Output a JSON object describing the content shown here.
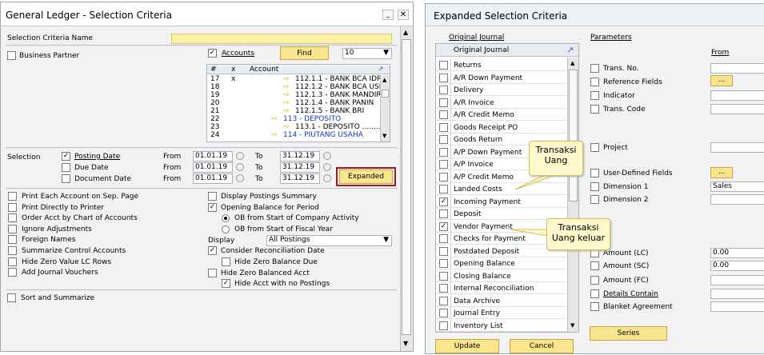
{
  "left": {
    "title": "General Ledger - Selection Criteria",
    "criteria_name_label": "Selection Criteria Name",
    "business_partner_label": "Business Partner",
    "accounts_label": "Accounts",
    "find_label": "Find",
    "count_value": "10",
    "grid_headers": [
      "#",
      "x",
      "Account"
    ],
    "grid_rows": [
      {
        "n": "17",
        "x": "x",
        "arrow": "⇨",
        "text": "112.1.1 - BANK BCA IDR",
        "blue": false,
        "indent": 1
      },
      {
        "n": "18",
        "x": "",
        "arrow": "⇨",
        "text": "112.1.2 - BANK BCA USD",
        "blue": false,
        "indent": 1
      },
      {
        "n": "19",
        "x": "",
        "arrow": "⇨",
        "text": "112.1.3 - BANK MANDIRI",
        "blue": false,
        "indent": 1
      },
      {
        "n": "20",
        "x": "",
        "arrow": "⇨",
        "text": "112.1.4 - BANK PANIN",
        "blue": false,
        "indent": 1
      },
      {
        "n": "21",
        "x": "",
        "arrow": "⇨",
        "text": "112.1.5 - BANK BRI",
        "blue": false,
        "indent": 1
      },
      {
        "n": "22",
        "x": "",
        "arrow": "⇨",
        "text": "113 - DEPOSITO",
        "blue": true,
        "indent": 0
      },
      {
        "n": "23",
        "x": "",
        "arrow": "⇨",
        "text": "113.1 - DEPOSITO ........",
        "blue": false,
        "indent": 1
      },
      {
        "n": "24",
        "x": "",
        "arrow": "⇨",
        "text": "114 - PIUTANG USAHA",
        "blue": true,
        "indent": 0
      }
    ],
    "selection_label": "Selection",
    "posting_date_label": "Posting Date",
    "due_date_label": "Due Date",
    "document_date_label": "Document Date",
    "from_label": "From",
    "to_label": "To",
    "dates": [
      {
        "from": "01.01.19",
        "to": "31.12.19"
      },
      {
        "from": "01.01.19",
        "to": "31.12.19"
      },
      {
        "from": "01.01.19",
        "to": "31.12.19"
      }
    ],
    "expanded_label": "Expanded",
    "opts_left": [
      "Print Each Account on Sep. Page",
      "Print Directly to Printer",
      "Order Acct by Chart of Accounts",
      "Ignore Adjustments",
      "Foreign Names",
      "Summarize Control Accounts",
      "Hide Zero Value LC Rows",
      "Add Journal Vouchers"
    ],
    "display_postings_summary": "Display Postings Summary",
    "opening_balance": "Opening Balance for Period",
    "ob_company": "OB from Start of Company Activity",
    "ob_fiscal": "OB from Start of Fiscal Year",
    "display_label": "Display",
    "display_value": "All Postings",
    "consider_recon": "Consider Reconciliation Date",
    "hide_zero_due": "Hide Zero Balance Due",
    "hide_zero_acct": "Hide Zero Balanced Acct",
    "hide_no_postings": "Hide Acct with no Postings",
    "sort_summarize": "Sort and Summarize"
  },
  "right": {
    "title": "Expanded Selection Criteria",
    "original_journal_tab": "Original Journal",
    "parameters_tab": "Parameters",
    "list_header": "Original Journal",
    "journal_items": [
      {
        "label": "Returns",
        "checked": false
      },
      {
        "label": "A/R Down Payment",
        "checked": false
      },
      {
        "label": "Delivery",
        "checked": false
      },
      {
        "label": "A/R Invoice",
        "checked": false
      },
      {
        "label": "A/R Credit Memo",
        "checked": false
      },
      {
        "label": "Goods Receipt PO",
        "checked": false
      },
      {
        "label": "Goods Return",
        "checked": false
      },
      {
        "label": "A/P Down Payment",
        "checked": false
      },
      {
        "label": "A/P Invoice",
        "checked": false
      },
      {
        "label": "A/P Credit Memo",
        "checked": false
      },
      {
        "label": "Landed Costs",
        "checked": false
      },
      {
        "label": "Incoming Payment",
        "checked": true
      },
      {
        "label": "Deposit",
        "checked": false
      },
      {
        "label": "Vendor Payment",
        "checked": true
      },
      {
        "label": "Checks for Payment",
        "checked": false
      },
      {
        "label": "Postdated Deposit",
        "checked": false
      },
      {
        "label": "Opening Balance",
        "checked": false
      },
      {
        "label": "Closing Balance",
        "checked": false
      },
      {
        "label": "Internal Reconciliation",
        "checked": false
      },
      {
        "label": "Data Archive",
        "checked": false
      },
      {
        "label": "Journal Entry",
        "checked": false
      },
      {
        "label": "Inventory List",
        "checked": false
      }
    ],
    "from_label": "From",
    "params": {
      "trans_no": "Trans. No.",
      "reference_fields": "Reference Fields",
      "indicator": "Indicator",
      "trans_code": "Trans. Code",
      "project": "Project",
      "udf": "User-Defined Fields",
      "dimension1": "Dimension 1",
      "dimension1_value": "Sales",
      "dimension2": "Dimension 2",
      "amount_lc": "Amount (LC)",
      "amount_lc_value": "0.00",
      "amount_sc": "Amount (SC)",
      "amount_sc_value": "0.00",
      "amount_fc": "Amount (FC)",
      "details_contain": "Details Contain",
      "blanket_agreement": "Blanket Agreement",
      "ellipsis": "..."
    },
    "series_label": "Series",
    "update_label": "Update",
    "cancel_label": "Cancel",
    "callout1": "Transaksi Uang",
    "callout2": "Transaksi Uang keluar"
  }
}
